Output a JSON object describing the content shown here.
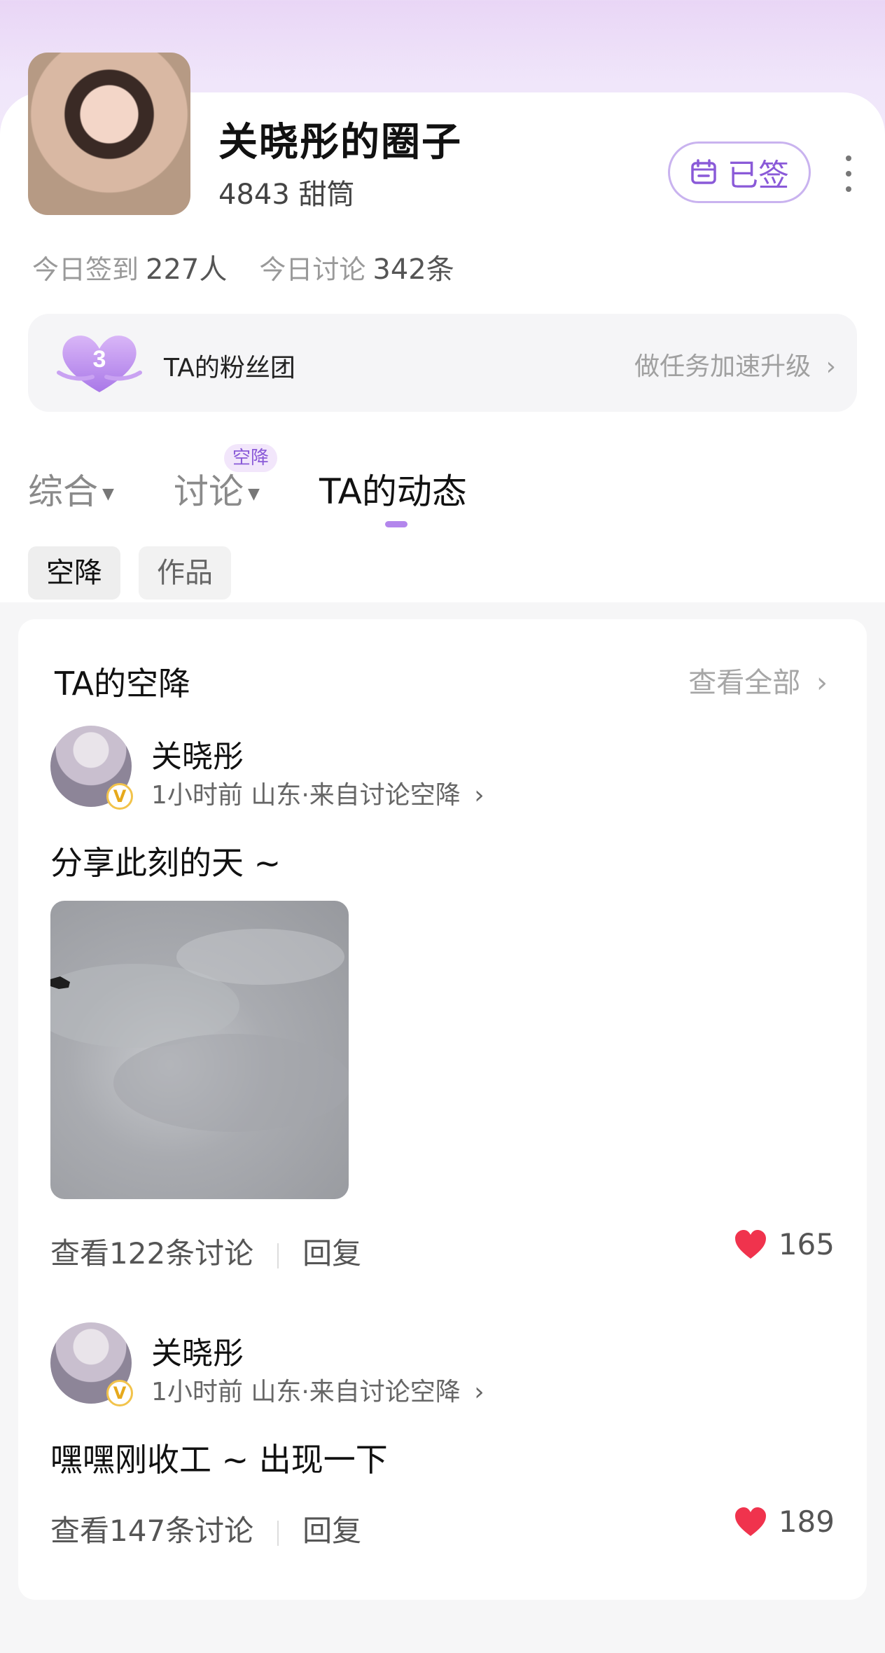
{
  "header": {
    "circle_title": "关晓彤的圈子",
    "fans_count": "4843 甜筒",
    "signed_label": "已签"
  },
  "stats": {
    "checkin_label": "今日签到",
    "checkin_value": "227人",
    "discuss_label": "今日讨论",
    "discuss_value": "342条"
  },
  "fan_club": {
    "level": "3",
    "label": "TA的粉丝团",
    "link": "做任务加速升级"
  },
  "tabs": [
    {
      "label": "综合"
    },
    {
      "label": "讨论",
      "badge": "空降"
    },
    {
      "label": "TA的动态"
    }
  ],
  "chips": [
    {
      "label": "空降",
      "active": true
    },
    {
      "label": "作品",
      "active": false
    }
  ],
  "section": {
    "title": "TA的空降",
    "see_all": "查看全部"
  },
  "posts": [
    {
      "author": "关晓彤",
      "verified": "V",
      "meta": "1小时前 山东·来自讨论空降",
      "text": "分享此刻的天 ~",
      "has_image": true,
      "discussions": "查看122条讨论",
      "reply": "回复",
      "likes": "165"
    },
    {
      "author": "关晓彤",
      "verified": "V",
      "meta": "1小时前 山东·来自讨论空降",
      "text": "嘿嘿刚收工 ~ 出现一下",
      "has_image": false,
      "discussions": "查看147条讨论",
      "reply": "回复",
      "likes": "189"
    }
  ],
  "colors": {
    "accent": "#8a5ad8",
    "like": "#f0334d"
  }
}
